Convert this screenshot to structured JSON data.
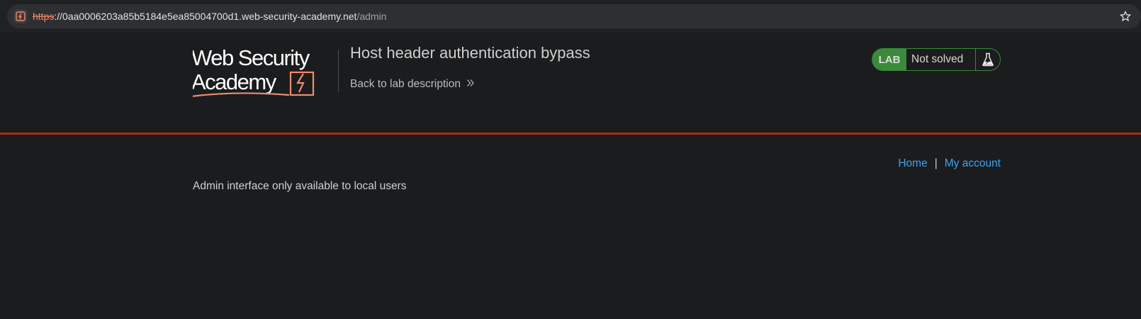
{
  "browser": {
    "url_scheme": "https",
    "url_separator": "://",
    "url_host": "0aa0006203a85b5184e5ea85004700d1.web-security-academy.net",
    "url_path": "/admin",
    "bookmark_icon": "star-icon",
    "site_icon": "lightning-icon"
  },
  "header": {
    "logo_line1": "Web Security",
    "logo_line2": "Academy",
    "lab_title": "Host header authentication bypass",
    "back_link": "Back to lab description",
    "lab_badge": "LAB",
    "lab_status": "Not solved",
    "accent_color": "#b5270b",
    "badge_color": "#3b8a3b"
  },
  "nav": {
    "home": "Home",
    "separator": "|",
    "my_account": "My account"
  },
  "main": {
    "message": "Admin interface only available to local users"
  }
}
